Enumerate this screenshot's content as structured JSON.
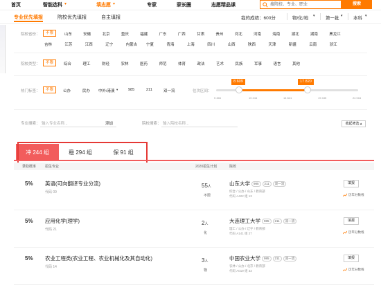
{
  "nav": {
    "items": [
      "首页",
      "智能选科",
      "填志愿",
      "专家",
      "家长圈",
      "志愿精品课"
    ],
    "dropdown_marks": [
      "▾",
      "▾"
    ],
    "search_placeholder": "搜院校、专业、职业",
    "search_button": "搜索"
  },
  "subnav": {
    "tabs": [
      "专业优先填报",
      "院校优先填报",
      "自主填报"
    ],
    "my_score": "我的成绩：600分",
    "subjects": "物/化/地",
    "batch": "第一批",
    "level": "本科"
  },
  "filters": {
    "province_label": "院校省份：",
    "no_limit": "不限",
    "provinces_row1": [
      "山东",
      "安徽",
      "北京",
      "重庆",
      "福建",
      "广东",
      "广西",
      "甘肃",
      "贵州",
      "河北",
      "河南",
      "海南",
      "湖北",
      "湖南",
      "黑龙江"
    ],
    "provinces_row2": [
      "吉林",
      "江苏",
      "江西",
      "辽宁",
      "内蒙古",
      "宁夏",
      "青海",
      "上海",
      "四川",
      "山西",
      "陕西",
      "天津",
      "新疆",
      "云南",
      "浙江"
    ],
    "type_label": "院校类型：",
    "types": [
      "综合",
      "理工",
      "财经",
      "农林",
      "医药",
      "师范",
      "体育",
      "政法",
      "艺术",
      "民族",
      "军事",
      "语言",
      "其他"
    ],
    "tag_label": "热门标签：",
    "tags": [
      "公办",
      "民办",
      "中外/港澳",
      "985",
      "211",
      "双一流"
    ],
    "rank_label": "位次区间：",
    "rank_low": "8 609",
    "rank_high": "17 820",
    "ticks": [
      "5 466",
      "10 244",
      "14 841",
      "19 435",
      "24 016"
    ],
    "major_search_label": "专业搜索：",
    "major_search_placeholder": "输入专业名称...",
    "add_label": "添加",
    "school_search_label": "院校搜索：",
    "school_search_placeholder": "输入院校名称...",
    "collapse_label": "收起筛选"
  },
  "groups": [
    {
      "label": "冲 244 组"
    },
    {
      "label": "稳 294 组"
    },
    {
      "label": "保 91 组"
    }
  ],
  "table_headers": [
    "录取概率",
    "招生专业",
    "2020招生计划",
    "院校"
  ],
  "rows": [
    {
      "prob": "5%",
      "major": "英语(可向翻译专业分流)",
      "code": "代码 09",
      "plan": "55",
      "plan_unit": "人",
      "plan_sub": "不限",
      "university": "山东大学",
      "uni_tags": [
        "985",
        "211",
        "双一流"
      ],
      "uni_info1": "综合 / 公办 / 山东 / 教育部",
      "uni_info2": "代码 A422 组 13",
      "fill": "填报",
      "history": "历年分数线"
    },
    {
      "prob": "5%",
      "major": "应用化学(理学)",
      "code": "代码 21",
      "plan": "2",
      "plan_unit": "人",
      "plan_sub": "化",
      "university": "大连理工大学",
      "uni_tags": [
        "985",
        "211",
        "双一流"
      ],
      "uni_info1": "理工 / 公办 / 辽宁 / 教育部",
      "uni_info2": "代码 A141 组 27",
      "fill": "填报",
      "history": "历年分数线"
    },
    {
      "prob": "5%",
      "major": "农业工程类(农业工程、农业机械化及其自动化)",
      "code": "代码 14",
      "plan": "3",
      "plan_unit": "人",
      "plan_sub": "物",
      "university": "中国农业大学",
      "uni_tags": [
        "985",
        "211",
        "双一流"
      ],
      "uni_info1": "农林 / 公办 / 北京 / 教育部",
      "uni_info2": "代码 A019 组 33",
      "fill": "填报",
      "history": "历年分数线"
    }
  ]
}
